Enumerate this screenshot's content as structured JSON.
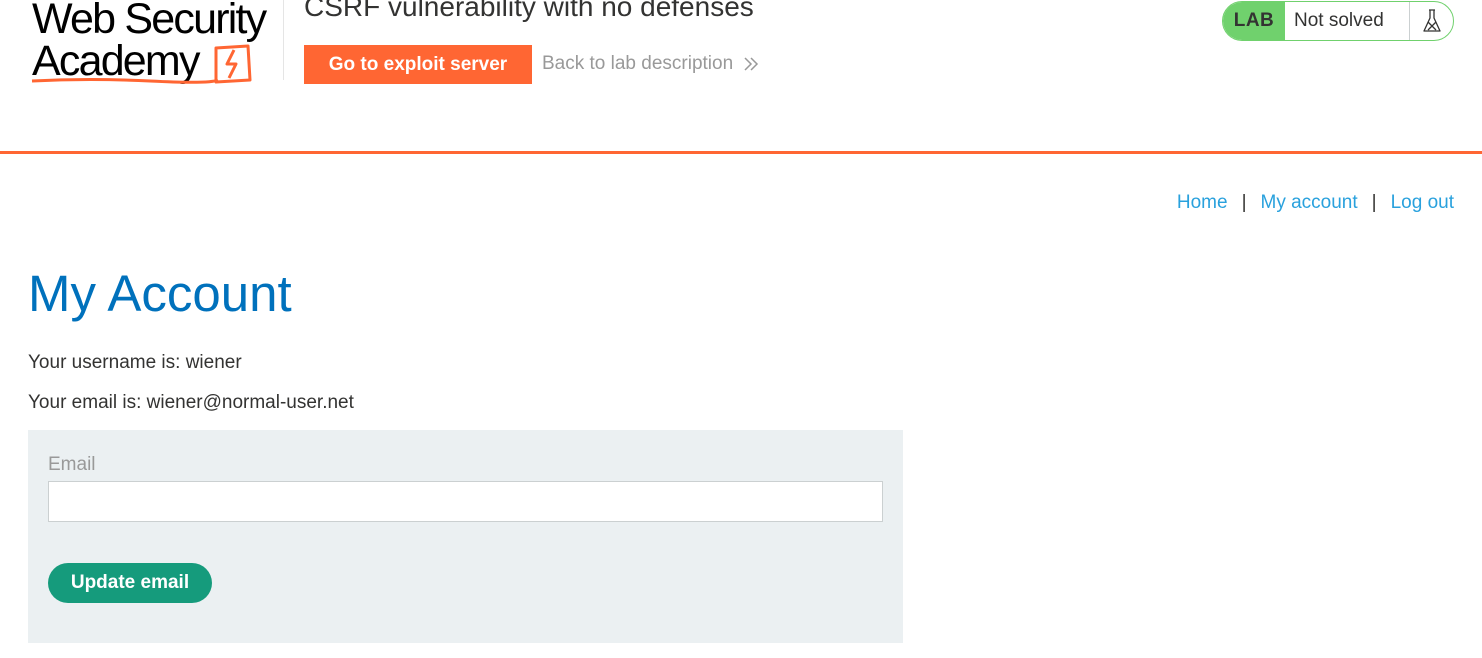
{
  "header": {
    "logo": {
      "line1": "Web Security",
      "line2": "Academy"
    },
    "lab_title": "CSRF vulnerability with no defenses",
    "exploit_button_label": "Go to exploit server",
    "back_link_label": "Back to lab description",
    "lab_status": {
      "badge": "LAB",
      "state": "Not solved"
    }
  },
  "nav": {
    "home": "Home",
    "my_account": "My account",
    "log_out": "Log out",
    "separator": "|"
  },
  "main": {
    "heading": "My Account",
    "username_line": "Your username is: wiener",
    "email_line": "Your email is: wiener@normal-user.net",
    "form": {
      "email_label": "Email",
      "email_value": "",
      "submit_label": "Update email"
    }
  },
  "colors": {
    "accent_orange": "#ff6633",
    "heading_blue": "#0071bc",
    "link_blue": "#29a1dd",
    "lab_green": "#70d16d",
    "button_green": "#159b7c",
    "panel_grey": "#ebf0f2"
  },
  "icons": {
    "logo_mark": "lightning-bolt-icon",
    "back_chevron": "double-chevron-right-icon",
    "lab_flask": "flask-icon"
  }
}
